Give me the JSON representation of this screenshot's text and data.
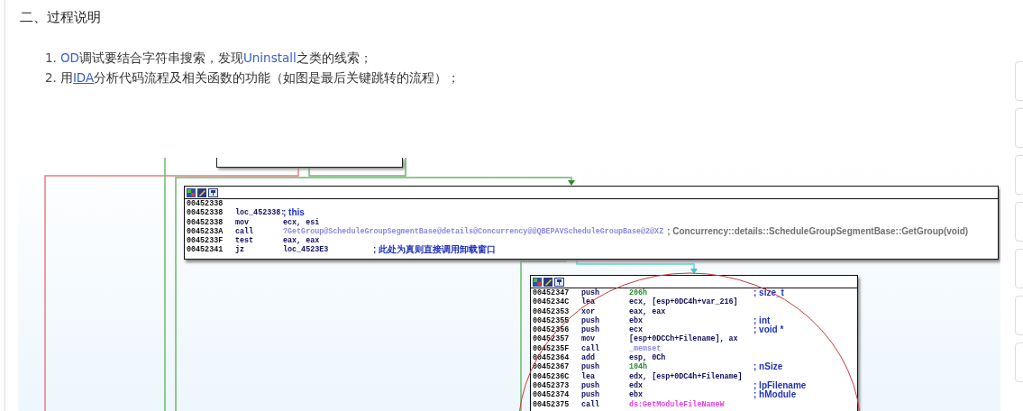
{
  "heading": "二、过程说明",
  "steps": [
    {
      "number": "1.",
      "parts": [
        {
          "kind": "highlight",
          "text": "OD"
        },
        {
          "kind": "text",
          "text": "调试要结合字符串搜索，发现"
        },
        {
          "kind": "highlight",
          "text": "Uninstall"
        },
        {
          "kind": "text",
          "text": "之类的线索；"
        }
      ]
    },
    {
      "number": "2.",
      "parts": [
        {
          "kind": "text",
          "text": "用"
        },
        {
          "kind": "link",
          "text": "IDA"
        },
        {
          "kind": "text",
          "text": "分析代码流程及相关函数的功能（如图是最后关键跳转的流程）；"
        }
      ]
    }
  ],
  "graph": {
    "blocks": [
      {
        "lines": [
          {
            "address": "00452338"
          },
          {
            "address": "00452338",
            "mnemonic": "loc_452338:",
            "comment": {
              "text": "; this",
              "color": "#2030c0"
            }
          },
          {
            "address": "00452338",
            "mnemonic": "mov",
            "operand": {
              "text": "ecx, esi",
              "color": "#101060"
            }
          },
          {
            "address": "0045233A",
            "mnemonic": "call",
            "operand": {
              "text": "?GetGroup@ScheduleGroupSegmentBase@details@Concurrency@@QBEPAVScheduleGroupBase@2@XZ",
              "color": "#8a8ae0"
            },
            "comment": {
              "text": "; Concurrency::details::ScheduleGroupSegmentBase::GetGroup(void)",
              "color": "#707070"
            }
          },
          {
            "address": "0045233F",
            "mnemonic": "test",
            "operand": {
              "text": "eax, eax",
              "color": "#101060"
            }
          },
          {
            "address": "00452341",
            "mnemonic": "jz",
            "operand": {
              "text": "loc_4523E3",
              "color": "#101060"
            },
            "comment": {
              "text": "; 此处为真则直接调用卸载窗口",
              "color": "#2030c0"
            }
          }
        ]
      },
      {
        "lines": [
          {
            "address": "00452347",
            "mnemonic": "push",
            "operand": {
              "text": "206h",
              "color": "#2a8a2a"
            },
            "comment": {
              "text": "; size_t",
              "color": "#2030c0"
            }
          },
          {
            "address": "0045234C",
            "mnemonic": "lea",
            "operand": {
              "text": "ecx, [esp+0DC4h+var_216]",
              "color": "#101060"
            }
          },
          {
            "address": "00452353",
            "mnemonic": "xor",
            "operand": {
              "text": "eax, eax",
              "color": "#101060"
            }
          },
          {
            "address": "00452355",
            "mnemonic": "push",
            "operand": {
              "text": "ebx",
              "color": "#101060"
            },
            "comment": {
              "text": "; int",
              "color": "#2030c0"
            }
          },
          {
            "address": "00452356",
            "mnemonic": "push",
            "operand": {
              "text": "ecx",
              "color": "#101060"
            },
            "comment": {
              "text": "; void *",
              "color": "#2030c0"
            }
          },
          {
            "address": "00452357",
            "mnemonic": "mov",
            "operand": {
              "text": "[esp+0DCCh+Filename], ax",
              "color": "#101060"
            }
          },
          {
            "address": "0045235F",
            "mnemonic": "call",
            "operand": {
              "text": "_memset",
              "color": "#8a8ae0"
            }
          },
          {
            "address": "00452364",
            "mnemonic": "add",
            "operand": {
              "text": "esp, 0Ch",
              "color": "#101060"
            }
          },
          {
            "address": "00452367",
            "mnemonic": "push",
            "operand": {
              "text": "104h",
              "color": "#2a8a2a"
            },
            "comment": {
              "text": "; nSize",
              "color": "#2030c0"
            }
          },
          {
            "address": "0045236C",
            "mnemonic": "lea",
            "operand": {
              "text": "edx, [esp+0DC4h+Filename]",
              "color": "#101060"
            }
          },
          {
            "address": "00452373",
            "mnemonic": "push",
            "operand": {
              "text": "edx",
              "color": "#101060"
            },
            "comment": {
              "text": "; lpFilename",
              "color": "#2030c0"
            }
          },
          {
            "address": "00452374",
            "mnemonic": "push",
            "operand": {
              "text": "ebx",
              "color": "#101060"
            },
            "comment": {
              "text": "; hModule",
              "color": "#2030c0"
            }
          },
          {
            "address": "00452375",
            "mnemonic": "call",
            "operand": {
              "text": "ds:GetModuleFileNameW",
              "color": "#e040e0"
            }
          }
        ]
      }
    ]
  }
}
